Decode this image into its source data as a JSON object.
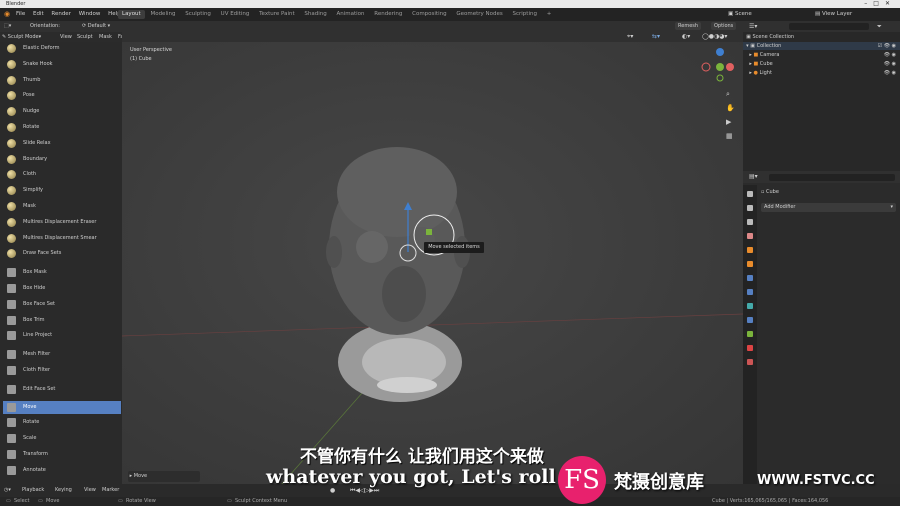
{
  "window": {
    "title": "Blender"
  },
  "menu": [
    "File",
    "Edit",
    "Render",
    "Window",
    "Help"
  ],
  "workspaces": [
    "Layout",
    "Modeling",
    "Sculpting",
    "UV Editing",
    "Texture Paint",
    "Shading",
    "Animation",
    "Rendering",
    "Compositing",
    "Geometry Nodes",
    "Scripting"
  ],
  "workspace_add": "+",
  "scene": {
    "label": "Scene",
    "view_layer": "View Layer"
  },
  "header": {
    "orientation_label": "Orientation:",
    "orientation_value": "Default",
    "remesh": "Remesh",
    "options": "Options",
    "mode": "Sculpt Mode",
    "menus": [
      "View",
      "Sculpt",
      "Mask",
      "Face Sets"
    ]
  },
  "viewport": {
    "perspective": "User Perspective",
    "object": "(1) Cube",
    "tooltip": "Move selected items",
    "operator_panel": "Move"
  },
  "tools": [
    {
      "label": "Elastic Deform"
    },
    {
      "label": "Snake Hook"
    },
    {
      "label": "Thumb"
    },
    {
      "label": "Pose"
    },
    {
      "label": "Nudge"
    },
    {
      "label": "Rotate"
    },
    {
      "label": "Slide Relax"
    },
    {
      "label": "Boundary"
    },
    {
      "label": "Cloth"
    },
    {
      "label": "Simplify"
    },
    {
      "label": "Mask"
    },
    {
      "label": "Multires Displacement Eraser"
    },
    {
      "label": "Multires Displacement Smear"
    },
    {
      "label": "Draw Face Sets"
    },
    {
      "label": "Box Mask"
    },
    {
      "label": "Box Hide"
    },
    {
      "label": "Box Face Set"
    },
    {
      "label": "Box Trim"
    },
    {
      "label": "Line Project"
    },
    {
      "label": "Mesh Filter"
    },
    {
      "label": "Cloth Filter"
    },
    {
      "label": "Edit Face Set"
    },
    {
      "label": "Move"
    },
    {
      "label": "Rotate"
    },
    {
      "label": "Scale"
    },
    {
      "label": "Transform"
    },
    {
      "label": "Annotate"
    }
  ],
  "selected_tool": "Move",
  "outliner": {
    "root": "Scene Collection",
    "collection": "Collection",
    "items": [
      "Camera",
      "Cube",
      "Light"
    ]
  },
  "properties": {
    "object_name": "Cube",
    "add_modifier": "Add Modifier"
  },
  "timeline": {
    "menus": [
      "Playback",
      "Keying",
      "View",
      "Marker"
    ]
  },
  "status": {
    "left": [
      "Select",
      "Move",
      "Rotate View",
      "Sculpt Context Menu"
    ],
    "right": "Cube | Verts:165,065/165,065 | Faces:164,056"
  },
  "subtitles": {
    "cn": "不管你有什么 让我们用这个来做",
    "en": "whatever you got, Let's roll w"
  },
  "watermark": {
    "logo": "FS",
    "cn": "梵摄创意库",
    "url": "WWW.FSTVC.CC"
  },
  "colors": {
    "accent": "#5680c2",
    "gizmo_x": "#e06060",
    "gizmo_y": "#7bb43c",
    "gizmo_z": "#3f7fd0",
    "watermark": "#e8216d"
  }
}
